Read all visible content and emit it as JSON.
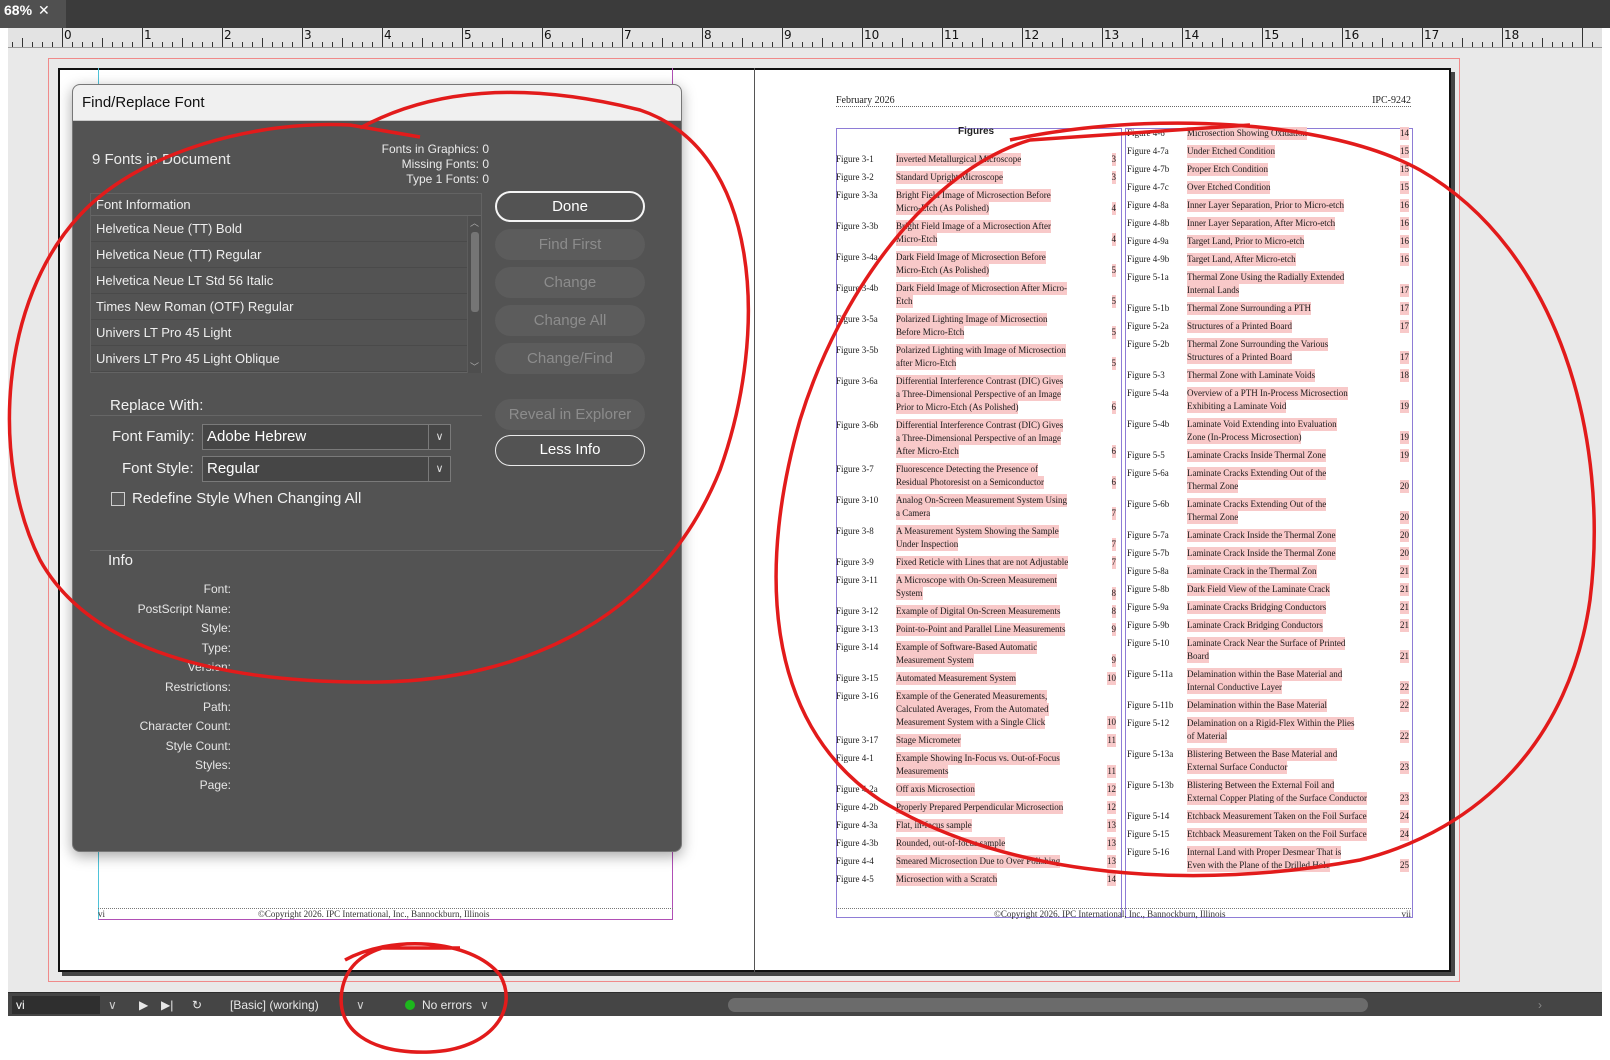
{
  "tab": {
    "label": "68%",
    "close": "✕"
  },
  "ruler": {
    "numbers": [
      "0",
      "1",
      "2",
      "3",
      "4",
      "5",
      "6",
      "7",
      "8",
      "9",
      "10",
      "11",
      "12",
      "13",
      "14",
      "15",
      "16",
      "17",
      "18"
    ]
  },
  "dialog": {
    "title": "Find/Replace Font",
    "fonts_count": "9 Fonts in Document",
    "stats": [
      "Fonts in Graphics: 0",
      "Missing Fonts: 0",
      "Type 1 Fonts: 0"
    ],
    "font_list_header": "Font Information",
    "fonts": [
      "Helvetica Neue (TT) Bold",
      "Helvetica Neue (TT) Regular",
      "Helvetica Neue LT Std 56 Italic",
      "Times New Roman (OTF) Regular",
      "Univers LT Pro 45 Light",
      "Univers LT Pro 45 Light Oblique"
    ],
    "buttons": {
      "done": "Done",
      "find_first": "Find First",
      "change": "Change",
      "change_all": "Change All",
      "change_find": "Change/Find",
      "reveal": "Reveal in Explorer",
      "less_info": "Less Info"
    },
    "replace_with": "Replace With:",
    "font_family_label": "Font Family:",
    "font_family_value": "Adobe Hebrew",
    "font_style_label": "Font Style:",
    "font_style_value": "Regular",
    "redefine_label": "Redefine Style When Changing All",
    "info_title": "Info",
    "info_labels": [
      "Font:",
      "PostScript Name:",
      "Style:",
      "Type:",
      "Version:",
      "Restrictions:",
      "Path:",
      "Character Count:",
      "Style Count:",
      "Styles:",
      "Page:"
    ]
  },
  "right_page": {
    "header_left": "February 2026",
    "header_right": "IPC-9242",
    "figures_title": "Figures",
    "footer": "©Copyright 2026. IPC International, Inc., Bannockburn, Illinois",
    "footer_page_right": "vii",
    "col1": [
      {
        "num": "Figure 3-1",
        "lines": [
          "Inverted Metallurgical Microscope"
        ],
        "page": "3"
      },
      {
        "num": "Figure 3-2",
        "lines": [
          "Standard Upright Microscope"
        ],
        "page": "3"
      },
      {
        "num": "Figure 3-3a",
        "lines": [
          "Bright Field Image of Microsection Before",
          "Micro-Etch (As Polished)"
        ],
        "page": "4"
      },
      {
        "num": "Figure 3-3b",
        "lines": [
          "Bright Field Image of a Microsection After",
          "Micro-Etch"
        ],
        "page": "4"
      },
      {
        "num": "Figure 3-4a",
        "lines": [
          "Dark Field Image of Microsection Before",
          "Micro-Etch (As Polished)"
        ],
        "page": "5"
      },
      {
        "num": "Figure 3-4b",
        "lines": [
          "Dark Field Image of Microsection After Micro-",
          "Etch"
        ],
        "page": "5"
      },
      {
        "num": "Figure 3-5a",
        "lines": [
          "Polarized Lighting Image of Microsection",
          "Before Micro-Etch"
        ],
        "page": "5"
      },
      {
        "num": "Figure 3-5b",
        "lines": [
          "Polarized Lighting with Image of Microsection",
          "after Micro-Etch"
        ],
        "page": "5"
      },
      {
        "num": "Figure 3-6a",
        "lines": [
          "Differential Interference Contrast (DIC) Gives",
          "a Three-Dimensional Perspective of an Image",
          "Prior to Micro-Etch (As Polished)"
        ],
        "page": "6"
      },
      {
        "num": "Figure 3-6b",
        "lines": [
          "Differential Interference Contrast (DIC) Gives",
          "a Three-Dimensional Perspective of an Image",
          "After Micro-Etch"
        ],
        "page": "6"
      },
      {
        "num": "Figure 3-7",
        "lines": [
          "Fluorescence Detecting the Presence of",
          "Residual Photoresist on a Semiconductor"
        ],
        "page": "6"
      },
      {
        "num": "Figure 3-10",
        "lines": [
          "Analog On-Screen Measurement System Using",
          "a Camera"
        ],
        "page": "7"
      },
      {
        "num": "Figure 3-8",
        "lines": [
          "A Measurement System Showing the Sample",
          "Under Inspection"
        ],
        "page": "7"
      },
      {
        "num": "Figure 3-9",
        "lines": [
          "Fixed Reticle with Lines that are not Adjustable"
        ],
        "page": "7"
      },
      {
        "num": "Figure 3-11",
        "lines": [
          "A Microscope with On-Screen Measurement",
          "System"
        ],
        "page": "8"
      },
      {
        "num": "Figure 3-12",
        "lines": [
          "Example of Digital On-Screen Measurements"
        ],
        "page": "8"
      },
      {
        "num": "Figure 3-13",
        "lines": [
          "Point-to-Point and Parallel Line Measurements"
        ],
        "page": "9"
      },
      {
        "num": "Figure 3-14",
        "lines": [
          "Example of Software-Based Automatic",
          "Measurement System"
        ],
        "page": "9"
      },
      {
        "num": "Figure 3-15",
        "lines": [
          "Automated Measurement System"
        ],
        "page": "10"
      },
      {
        "num": "Figure 3-16",
        "lines": [
          "Example of the Generated Measurements,",
          "Calculated Averages, From the Automated",
          "Measurement System with a Single Click"
        ],
        "page": "10"
      },
      {
        "num": "Figure 3-17",
        "lines": [
          "Stage Micrometer"
        ],
        "page": "11"
      },
      {
        "num": "Figure 4-1",
        "lines": [
          "Example Showing In-Focus vs. Out-of-Focus",
          "Measurements"
        ],
        "page": "11"
      },
      {
        "num": "Figure 4-2a",
        "lines": [
          "Off axis Microsection"
        ],
        "page": "12"
      },
      {
        "num": "Figure 4-2b",
        "lines": [
          "Properly Prepared Perpendicular Microsection"
        ],
        "page": "12"
      },
      {
        "num": "Figure 4-3a",
        "lines": [
          "Flat, in-focus sample"
        ],
        "page": "13"
      },
      {
        "num": "Figure 4-3b",
        "lines": [
          "Rounded, out-of-focus sample"
        ],
        "page": "13"
      },
      {
        "num": "Figure 4-4",
        "lines": [
          "Smeared Microsection Due to Over Polishing"
        ],
        "page": "13"
      },
      {
        "num": "Figure 4-5",
        "lines": [
          "Microsection with a Scratch"
        ],
        "page": "14"
      }
    ],
    "col2": [
      {
        "num": "Figure 4-6",
        "lines": [
          "Microsection Showing Oxidation"
        ],
        "page": "14"
      },
      {
        "num": "Figure 4-7a",
        "lines": [
          "Under Etched Condition"
        ],
        "page": "15"
      },
      {
        "num": "Figure 4-7b",
        "lines": [
          "Proper Etch Condition"
        ],
        "page": "15"
      },
      {
        "num": "Figure 4-7c",
        "lines": [
          "Over Etched Condition"
        ],
        "page": "15"
      },
      {
        "num": "Figure 4-8a",
        "lines": [
          "Inner Layer Separation, Prior to Micro-etch"
        ],
        "page": "16"
      },
      {
        "num": "Figure 4-8b",
        "lines": [
          "Inner Layer Separation, After Micro-etch"
        ],
        "page": "16"
      },
      {
        "num": "Figure 4-9a",
        "lines": [
          "Target Land, Prior to Micro-etch"
        ],
        "page": "16"
      },
      {
        "num": "Figure 4-9b",
        "lines": [
          "Target Land, After Micro-etch"
        ],
        "page": "16"
      },
      {
        "num": "Figure 5-1a",
        "lines": [
          "Thermal Zone Using the Radially Extended",
          "Internal Lands"
        ],
        "page": "17"
      },
      {
        "num": "Figure 5-1b",
        "lines": [
          "Thermal Zone Surrounding a PTH"
        ],
        "page": "17"
      },
      {
        "num": "Figure 5-2a",
        "lines": [
          "Structures of a Printed Board"
        ],
        "page": "17"
      },
      {
        "num": "Figure 5-2b",
        "lines": [
          "Thermal Zone Surrounding the Various",
          "Structures of a Printed Board"
        ],
        "page": "17"
      },
      {
        "num": "Figure 5-3",
        "lines": [
          "Thermal Zone with Laminate Voids"
        ],
        "page": "18"
      },
      {
        "num": "Figure 5-4a",
        "lines": [
          "Overview of a PTH In-Process Microsection",
          "Exhibiting a Laminate Void"
        ],
        "page": "19"
      },
      {
        "num": "Figure 5-4b",
        "lines": [
          "Laminate Void Extending into Evaluation",
          "Zone (In-Process Microsection)"
        ],
        "page": "19"
      },
      {
        "num": "Figure 5-5",
        "lines": [
          "Laminate Cracks Inside Thermal Zone"
        ],
        "page": "19"
      },
      {
        "num": "Figure 5-6a",
        "lines": [
          "Laminate Cracks Extending Out of the",
          "Thermal Zone"
        ],
        "page": "20"
      },
      {
        "num": "Figure 5-6b",
        "lines": [
          "Laminate Cracks Extending Out of the",
          "Thermal Zone"
        ],
        "page": "20"
      },
      {
        "num": "Figure 5-7a",
        "lines": [
          "Laminate Crack Inside the Thermal Zone"
        ],
        "page": "20"
      },
      {
        "num": "Figure 5-7b",
        "lines": [
          "Laminate Crack Inside the Thermal Zone"
        ],
        "page": "20"
      },
      {
        "num": "Figure 5-8a",
        "lines": [
          "Laminate Crack in the Thermal Zon"
        ],
        "page": "21"
      },
      {
        "num": "Figure 5-8b",
        "lines": [
          "Dark Field View of the Laminate Crack"
        ],
        "page": "21"
      },
      {
        "num": "Figure 5-9a",
        "lines": [
          "Laminate Cracks Bridging Conductors"
        ],
        "page": "21"
      },
      {
        "num": "Figure 5-9b",
        "lines": [
          "Laminate Crack Bridging Conductors"
        ],
        "page": "21"
      },
      {
        "num": "Figure 5-10",
        "lines": [
          "Laminate Crack Near the Surface of Printed",
          "Board"
        ],
        "page": "21"
      },
      {
        "num": "Figure 5-11a",
        "lines": [
          "Delamination within the Base Material and",
          "Internal Conductive Layer"
        ],
        "page": "22"
      },
      {
        "num": "Figure 5-11b",
        "lines": [
          "Delamination within the Base Material"
        ],
        "page": "22"
      },
      {
        "num": "Figure 5-12",
        "lines": [
          "Delamination on a Rigid-Flex Within the Plies",
          "of Material"
        ],
        "page": "22"
      },
      {
        "num": "Figure 5-13a",
        "lines": [
          "Blistering Between the Base Material and",
          "External Surface Conductor"
        ],
        "page": "23"
      },
      {
        "num": "Figure 5-13b",
        "lines": [
          "Blistering Between the External Foil and",
          "External Copper Plating of the Surface Conductor"
        ],
        "page": "23"
      },
      {
        "num": "Figure 5-14",
        "lines": [
          "Etchback Measurement Taken on the Foil Surface"
        ],
        "page": "24"
      },
      {
        "num": "Figure 5-15",
        "lines": [
          "Etchback Measurement Taken on the Foil Surface"
        ],
        "page": "24"
      },
      {
        "num": "Figure 5-16",
        "lines": [
          "Internal Land with Proper Desmear That is",
          "Even with the Plane of the Drilled Hole"
        ],
        "page": "25"
      }
    ]
  },
  "left_page": {
    "footer": "©Copyright 2026. IPC International, Inc., Bannockburn, Illinois",
    "footer_page_left": "vi"
  },
  "status_bar": {
    "page": "vi",
    "style": "[Basic] (working)",
    "preflight": "No errors"
  },
  "colors": {
    "highlight": "#f8c9c9",
    "annotation": "#e21b1b",
    "preflight_ok": "#1db71d"
  }
}
